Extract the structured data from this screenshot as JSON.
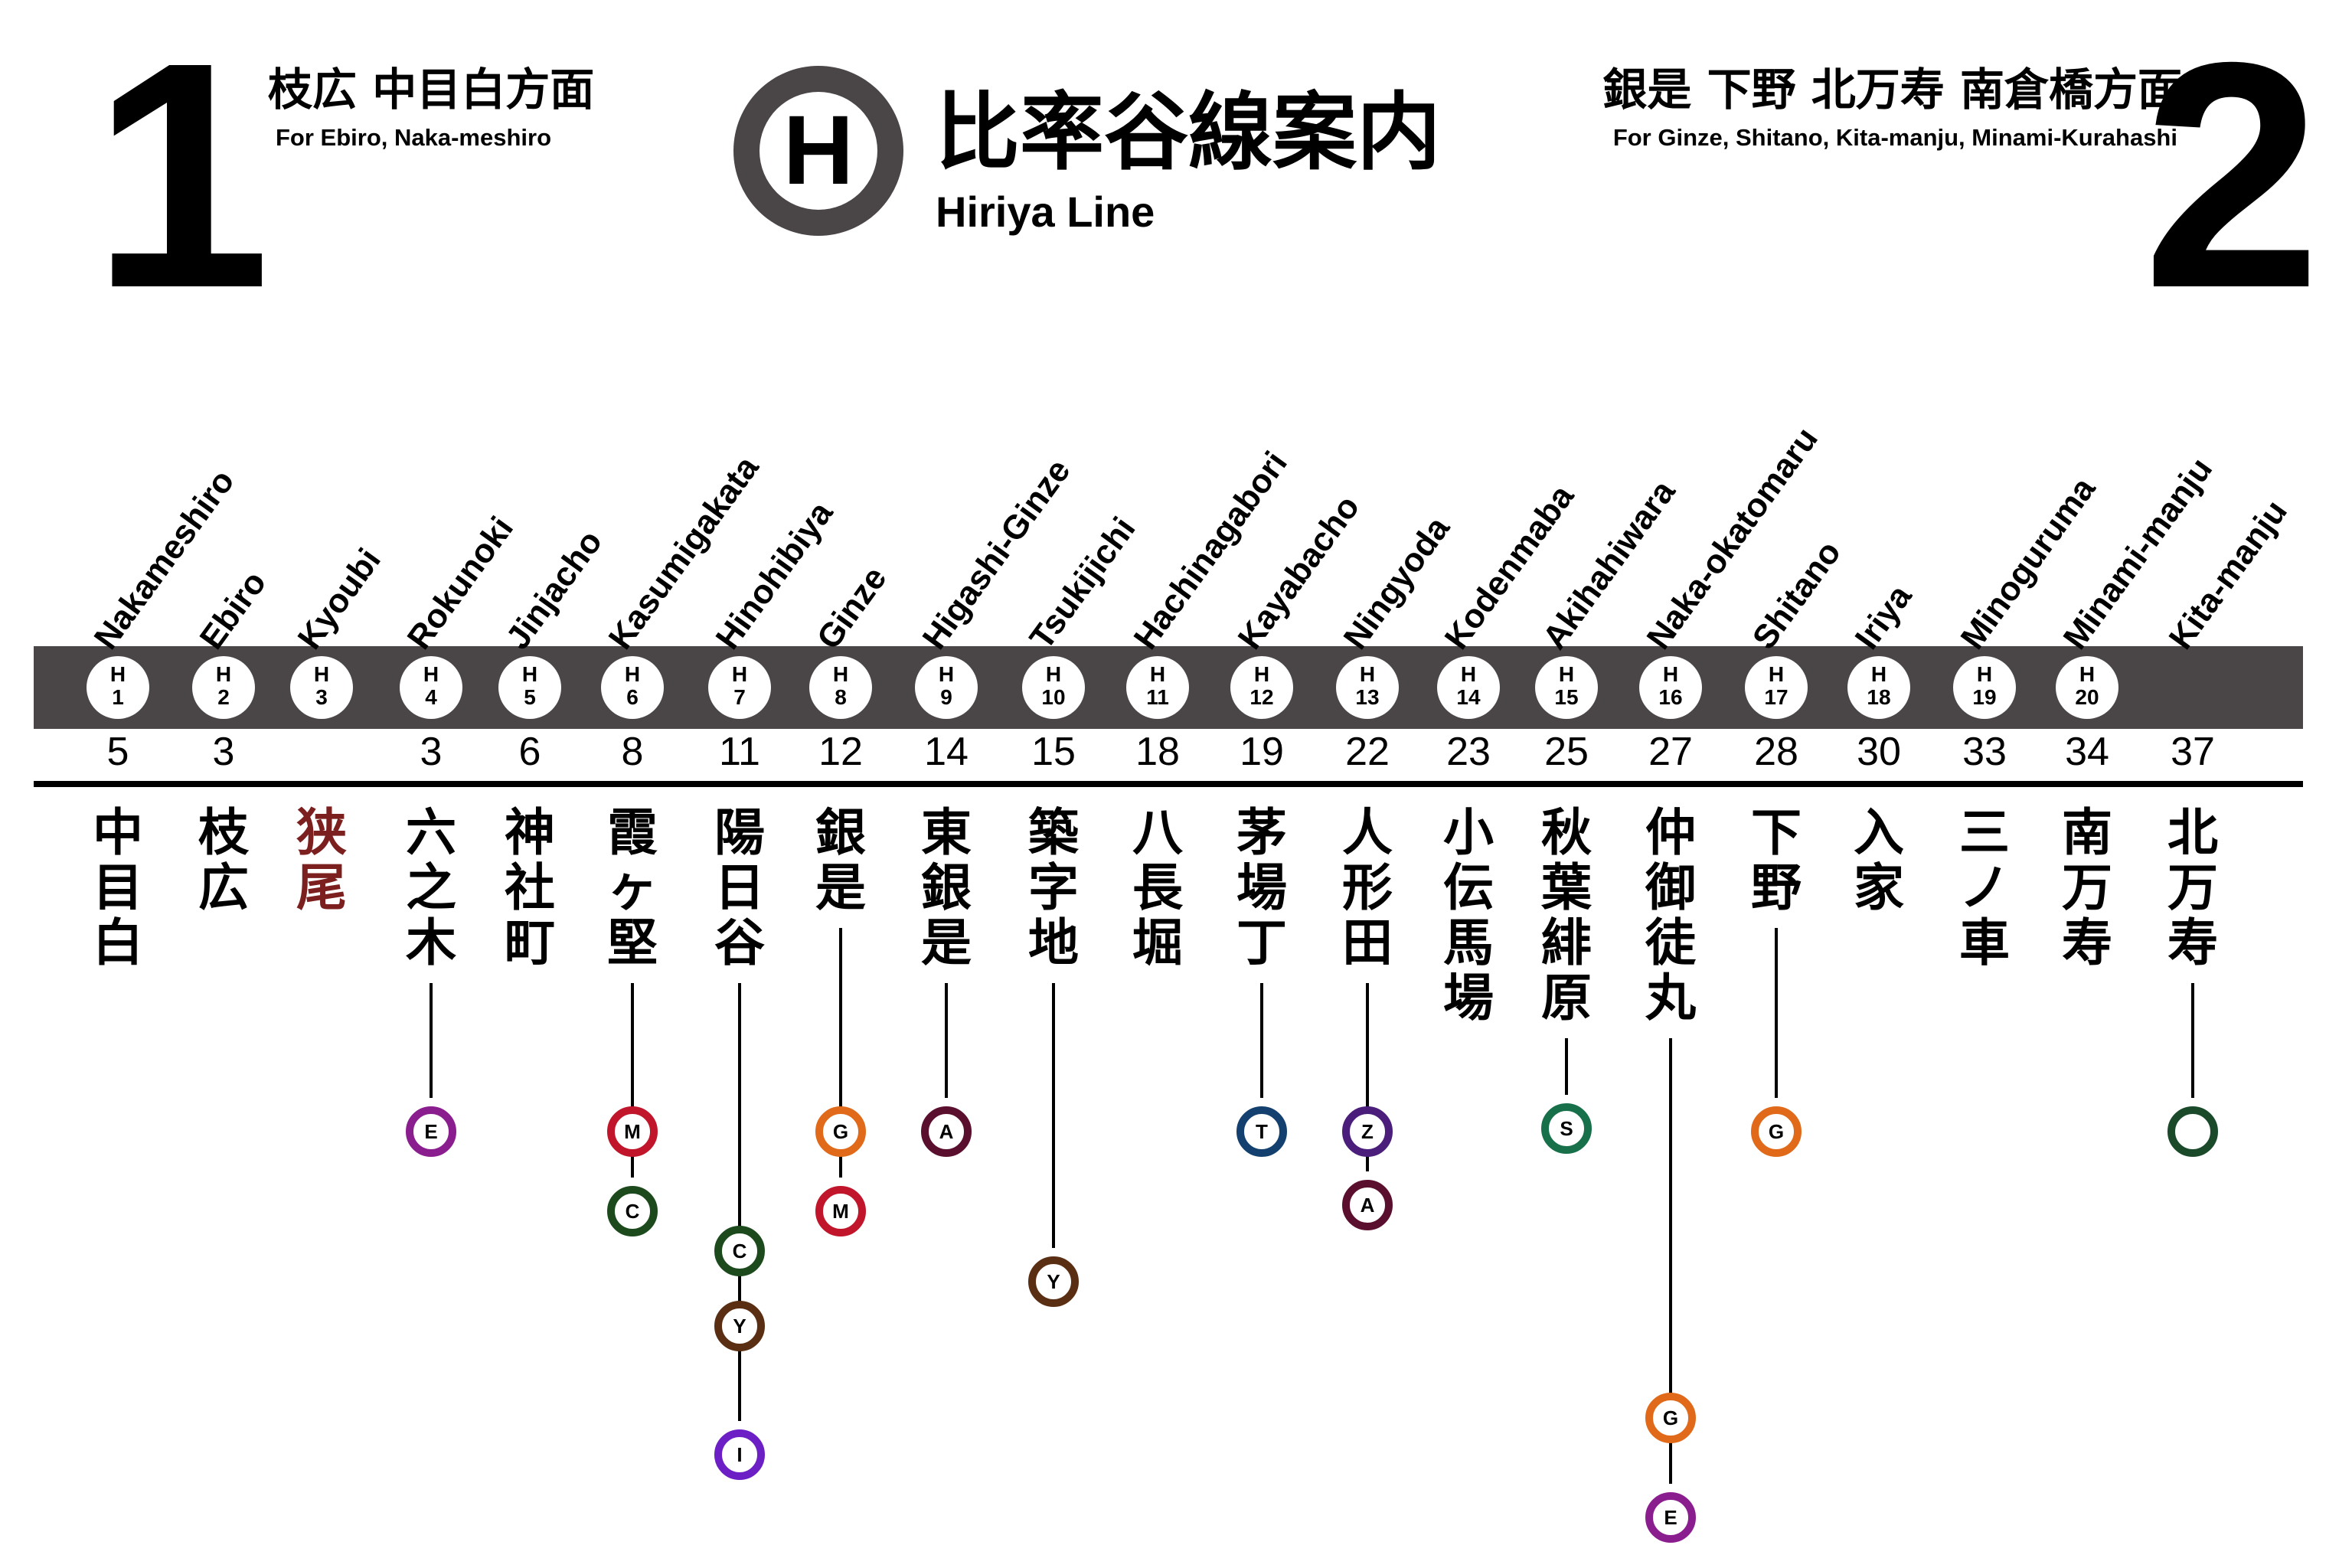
{
  "header": {
    "platform_left": {
      "number": "1",
      "dest_jp": "枝広 中目白方面",
      "dest_en": "For Ebiro, Naka-meshiro"
    },
    "platform_right": {
      "number": "2",
      "dest_jp": "銀是 下野 北万寿 南倉橋方面",
      "dest_en": "For Ginze, Shitano, Kita-manju, Minami-Kurahashi"
    },
    "logo_letter": "H",
    "title_jp": "比率谷線案内",
    "title_en": "Hiriya Line"
  },
  "colors": {
    "line_bar": "#4a4546",
    "ebiro_red": "#7b1f1f"
  },
  "stations": [
    {
      "en": "Nakameshiro",
      "jp": "中目白",
      "code_letter": "H",
      "code_num": "1",
      "minutes": "5",
      "transfers": []
    },
    {
      "en": "Ebiro",
      "jp": "枝広",
      "code_letter": "H",
      "code_num": "2",
      "minutes": "3",
      "transfers": []
    },
    {
      "en": "Kyoubi",
      "jp": "狭尾",
      "code_letter": "H",
      "code_num": "3",
      "minutes": "",
      "highlight": true,
      "transfers": []
    },
    {
      "en": "Rokunoki",
      "jp": "六之木",
      "code_letter": "H",
      "code_num": "4",
      "minutes": "3",
      "transfers": [
        {
          "letter": "E",
          "color": "#8b1e8f"
        }
      ]
    },
    {
      "en": "Jinjacho",
      "jp": "神社町",
      "code_letter": "H",
      "code_num": "5",
      "minutes": "6",
      "transfers": []
    },
    {
      "en": "Kasumigakata",
      "jp": "霞ヶ堅",
      "code_letter": "H",
      "code_num": "6",
      "minutes": "8",
      "transfers": [
        {
          "letter": "M",
          "color": "#c0152a"
        },
        {
          "letter": "C",
          "color": "#1d4a1d"
        }
      ]
    },
    {
      "en": "Hinohibiya",
      "jp": "陽日谷",
      "code_letter": "H",
      "code_num": "7",
      "minutes": "11",
      "transfers": [
        {
          "letter": "C",
          "color": "#1d4a1d"
        },
        {
          "letter": "Y",
          "color": "#5a2e12"
        },
        {
          "letter": "I",
          "color": "#6b1fc4"
        }
      ]
    },
    {
      "en": "Ginze",
      "jp": "銀是",
      "code_letter": "H",
      "code_num": "8",
      "minutes": "12",
      "transfers": [
        {
          "letter": "G",
          "color": "#e06a1a"
        },
        {
          "letter": "M",
          "color": "#c0152a"
        }
      ]
    },
    {
      "en": "Higashi-Ginze",
      "jp": "東銀是",
      "code_letter": "H",
      "code_num": "9",
      "minutes": "14",
      "transfers": [
        {
          "letter": "A",
          "color": "#5a0f2e"
        }
      ]
    },
    {
      "en": "Tsukijichi",
      "jp": "築字地",
      "code_letter": "H",
      "code_num": "10",
      "minutes": "15",
      "transfers": [
        {
          "letter": "Y",
          "color": "#5a2e12"
        }
      ]
    },
    {
      "en": "Hachinagabori",
      "jp": "八長堀",
      "code_letter": "H",
      "code_num": "11",
      "minutes": "18",
      "transfers": []
    },
    {
      "en": "Kayabacho",
      "jp": "茅場丁",
      "code_letter": "H",
      "code_num": "12",
      "minutes": "19",
      "transfers": [
        {
          "letter": "T",
          "color": "#13406e"
        }
      ]
    },
    {
      "en": "Ningyoda",
      "jp": "人形田",
      "code_letter": "H",
      "code_num": "13",
      "minutes": "22",
      "transfers": [
        {
          "letter": "Z",
          "color": "#4a1e7a"
        },
        {
          "letter": "A",
          "color": "#5a0f2e"
        }
      ]
    },
    {
      "en": "Kodenmaba",
      "jp": "小伝馬場",
      "code_letter": "H",
      "code_num": "14",
      "minutes": "23",
      "transfers": []
    },
    {
      "en": "Akihahiwara",
      "jp": "秋葉緋原",
      "code_letter": "H",
      "code_num": "15",
      "minutes": "25",
      "transfers": [
        {
          "letter": "S",
          "color": "#17704a"
        }
      ]
    },
    {
      "en": "Naka-okatomaru",
      "jp": "仲御徒丸",
      "code_letter": "H",
      "code_num": "16",
      "minutes": "27",
      "transfers": [
        {
          "letter": "G",
          "color": "#e06a1a"
        },
        {
          "letter": "E",
          "color": "#8b1e8f"
        }
      ]
    },
    {
      "en": "Shitano",
      "jp": "下野",
      "code_letter": "H",
      "code_num": "17",
      "minutes": "28",
      "transfers": [
        {
          "letter": "G",
          "color": "#e06a1a"
        }
      ]
    },
    {
      "en": "Iriya",
      "jp": "入家",
      "code_letter": "H",
      "code_num": "18",
      "minutes": "30",
      "transfers": []
    },
    {
      "en": "Minoguruma",
      "jp": "三ノ車",
      "code_letter": "H",
      "code_num": "19",
      "minutes": "33",
      "transfers": []
    },
    {
      "en": "Minami-manju",
      "jp": "南万寿",
      "code_letter": "H",
      "code_num": "20",
      "minutes": "34",
      "transfers": []
    },
    {
      "en": "Kita-manju",
      "jp": "北万寿",
      "code_letter": "",
      "code_num": "",
      "minutes": "37",
      "transfers": [
        {
          "letter": "",
          "color": "#1a4a2a"
        }
      ]
    }
  ]
}
